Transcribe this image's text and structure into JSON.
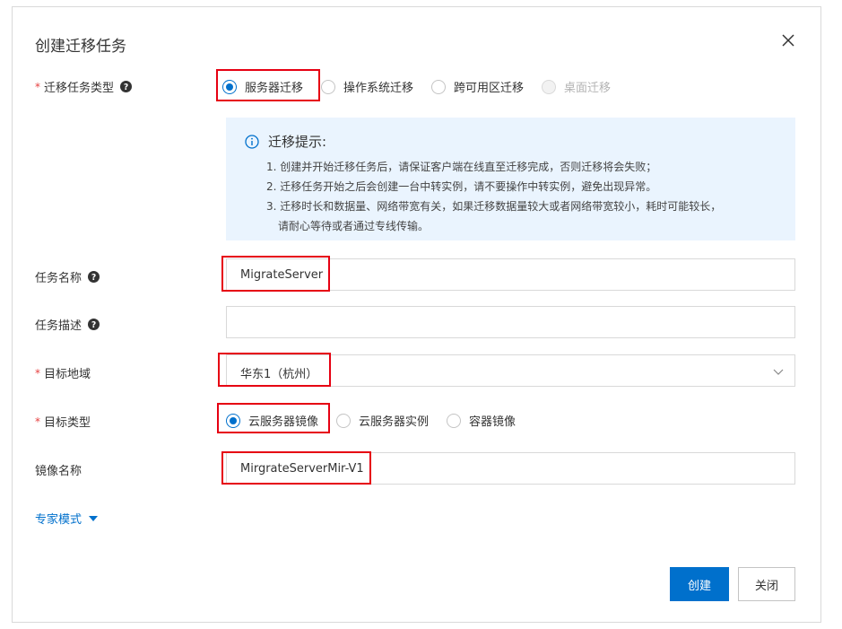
{
  "dialog": {
    "title": "创建迁移任务",
    "close_icon": "close-icon"
  },
  "task_type": {
    "label": "迁移任务类型",
    "required": true,
    "options": [
      {
        "label": "服务器迁移",
        "checked": true,
        "disabled": false
      },
      {
        "label": "操作系统迁移",
        "checked": false,
        "disabled": false
      },
      {
        "label": "跨可用区迁移",
        "checked": false,
        "disabled": false
      },
      {
        "label": "桌面迁移",
        "checked": false,
        "disabled": true
      }
    ]
  },
  "tip": {
    "title": "迁移提示:",
    "lines": [
      "1. 创建并开始迁移任务后，请保证客户端在线直至迁移完成，否则迁移将会失败；",
      "2. 迁移任务开始之后会创建一台中转实例，请不要操作中转实例，避免出现异常。",
      "3. 迁移时长和数据量、网络带宽有关，如果迁移数据量较大或者网络带宽较小，耗时可能较长，",
      "请耐心等待或者通过专线传输。"
    ]
  },
  "task_name": {
    "label": "任务名称",
    "value": "MigrateServer"
  },
  "task_desc": {
    "label": "任务描述",
    "value": ""
  },
  "target_region": {
    "label": "目标地域",
    "required": true,
    "value": "华东1（杭州）"
  },
  "target_type": {
    "label": "目标类型",
    "required": true,
    "options": [
      {
        "label": "云服务器镜像",
        "checked": true
      },
      {
        "label": "云服务器实例",
        "checked": false
      },
      {
        "label": "容器镜像",
        "checked": false
      }
    ]
  },
  "image_name": {
    "label": "镜像名称",
    "value": "MirgrateServerMir-V1"
  },
  "expert_mode": {
    "label": "专家模式"
  },
  "buttons": {
    "create": "创建",
    "close": "关闭"
  },
  "colors": {
    "primary": "#0070cc",
    "highlight": "#e60012",
    "tip_bg": "#eaf4fe",
    "required": "#e64141"
  }
}
